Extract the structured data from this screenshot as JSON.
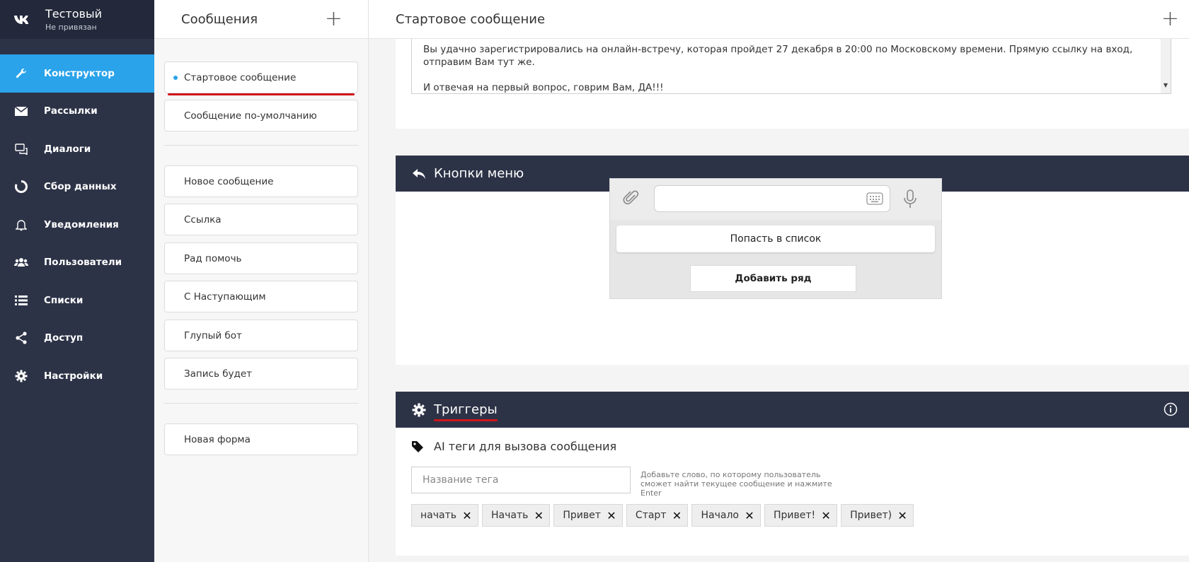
{
  "brand": {
    "title": "Тестовый",
    "subtitle": "Не привязан"
  },
  "sidebar": {
    "items": [
      {
        "label": "Конструктор",
        "icon": "wrench-icon"
      },
      {
        "label": "Рассылки",
        "icon": "envelope-icon"
      },
      {
        "label": "Диалоги",
        "icon": "chat-icon"
      },
      {
        "label": "Сбор данных",
        "icon": "circle-progress-icon"
      },
      {
        "label": "Уведомления",
        "icon": "bell-icon"
      },
      {
        "label": "Пользователи",
        "icon": "users-icon"
      },
      {
        "label": "Списки",
        "icon": "list-icon"
      },
      {
        "label": "Доступ",
        "icon": "share-icon"
      },
      {
        "label": "Настройки",
        "icon": "gear-icon"
      }
    ]
  },
  "messages": {
    "title": "Сообщения",
    "group1": [
      "Стартовое сообщение",
      "Сообщение по-умолчанию"
    ],
    "group2": [
      "Новое сообщение",
      "Ссылка",
      "Рад помочь",
      "С Наступающим",
      "Глупый бот",
      "Запись будет"
    ],
    "group3": [
      "Новая форма"
    ]
  },
  "main": {
    "title": "Стартовое сообщение",
    "text_line1": "Вы удачно зарегистрировались на онлайн-встречу, которая пройдет 27 декабря в 20:00 по Московскому времени. Прямую ссылку на вход, отправим Вам тут же.",
    "text_line2": "И отвечая на первый вопрос, говрим Вам, ДА!!!"
  },
  "menu_buttons": {
    "title": "Кнопки меню",
    "button1": "Попасть в список",
    "add_row": "Добавить ряд"
  },
  "triggers": {
    "title": "Триггеры",
    "tags_title": "AI теги для вызова сообщения",
    "input_placeholder": "Название тега",
    "hint": "Добавьте слово, по которому пользователь сможет найти текущее сообщение и нажмите Enter",
    "tags": [
      "начать",
      "Начать",
      "Привет",
      "Старт",
      "Начало",
      "Привет!",
      "Привет)"
    ]
  },
  "colors": {
    "sidebar": "#2d3347",
    "accent": "#2aa3ea",
    "underline": "#d0141a"
  }
}
